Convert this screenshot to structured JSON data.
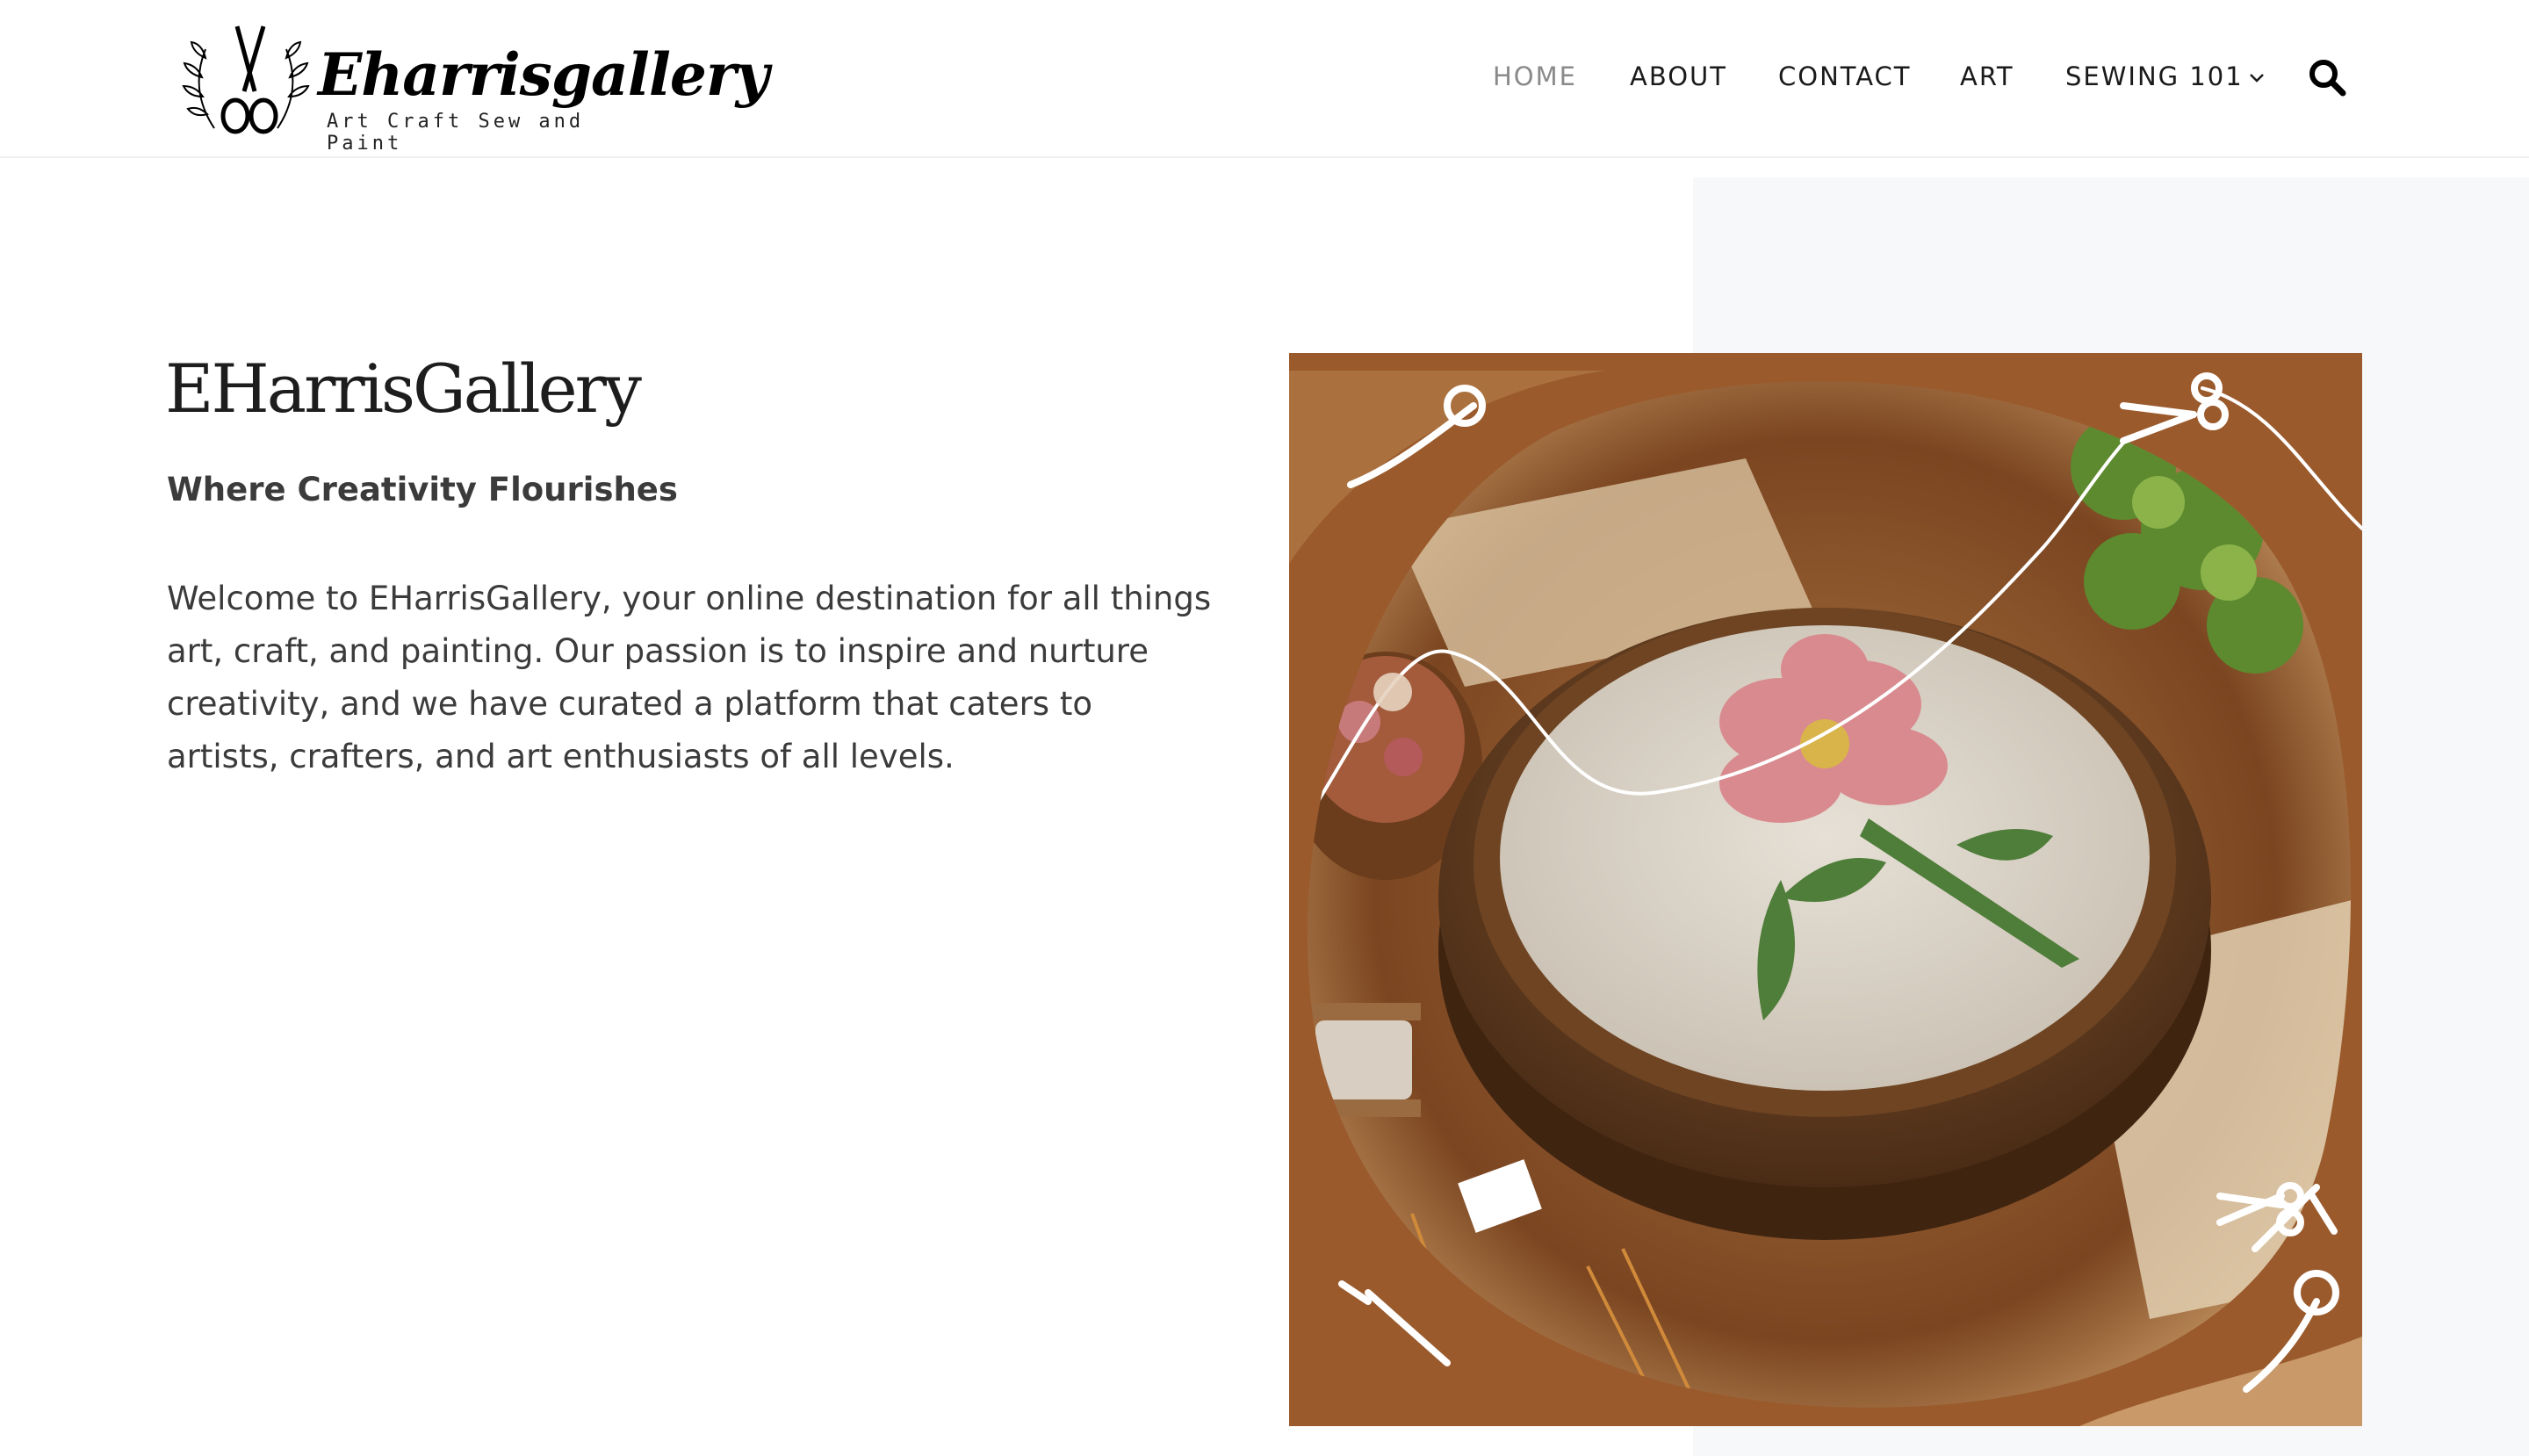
{
  "brand": {
    "name": "Eharrisgallery",
    "tagline": "Art Craft Sew and Paint"
  },
  "nav": {
    "items": [
      {
        "label": "HOME",
        "active": true
      },
      {
        "label": "ABOUT",
        "active": false
      },
      {
        "label": "CONTACT",
        "active": false
      },
      {
        "label": "ART",
        "active": false
      },
      {
        "label": "SEWING 101",
        "active": false,
        "has_dropdown": true
      }
    ],
    "search_icon": "search-icon"
  },
  "hero": {
    "title": "EHarrisGallery",
    "subtitle": "Where Creativity Flourishes",
    "body": "Welcome to EHarrisGallery, your online destination for all things art, craft, and painting. Our passion is to inspire and nurture creativity, and we have curated a platform that caters to artists, crafters, and art enthusiasts of all levels.",
    "image_subject": "embroidery-hoop-illustration"
  },
  "colors": {
    "accent_brown": "#9a5a2c",
    "panel_gray": "#f7f8fa",
    "nav_active": "#8a8a8a",
    "text_dark": "#1d1d1d"
  }
}
